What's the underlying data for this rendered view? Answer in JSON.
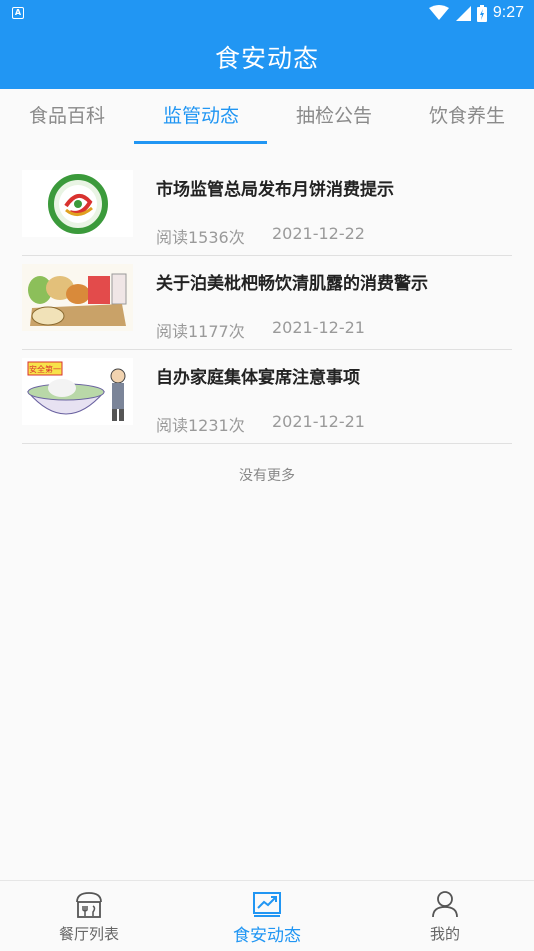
{
  "status": {
    "time": "9:27",
    "app_icon_letter": "A"
  },
  "header": {
    "title": "食安动态"
  },
  "tabs": [
    {
      "label": "食品百科",
      "active": false
    },
    {
      "label": "监管动态",
      "active": true
    },
    {
      "label": "抽检公告",
      "active": false
    },
    {
      "label": "饮食养生",
      "active": false
    }
  ],
  "news": [
    {
      "title": "市场监管总局发布月饼消费提示",
      "reads": "阅读1536次",
      "date": "2021-12-22",
      "thumb_icon": "food-safety-logo"
    },
    {
      "title": "关于泊美枇杷畅饮清肌露的消费警示",
      "reads": "阅读1177次",
      "date": "2021-12-21",
      "thumb_icon": "food-safety-cartoon"
    },
    {
      "title": "自办家庭集体宴席注意事项",
      "reads": "阅读1231次",
      "date": "2021-12-21",
      "thumb_icon": "safety-first-bowl-cartoon"
    }
  ],
  "thumb_text": {
    "item3_badge": "安全第一"
  },
  "footer": {
    "no_more": "没有更多"
  },
  "bottom_nav": [
    {
      "label": "餐厅列表",
      "icon": "restaurant-icon",
      "active": false
    },
    {
      "label": "食安动态",
      "icon": "chart-trend-icon",
      "active": true
    },
    {
      "label": "我的",
      "icon": "user-icon",
      "active": false
    }
  ],
  "colors": {
    "primary": "#2196f3",
    "text": "#222222",
    "muted": "#9a9a9a"
  }
}
